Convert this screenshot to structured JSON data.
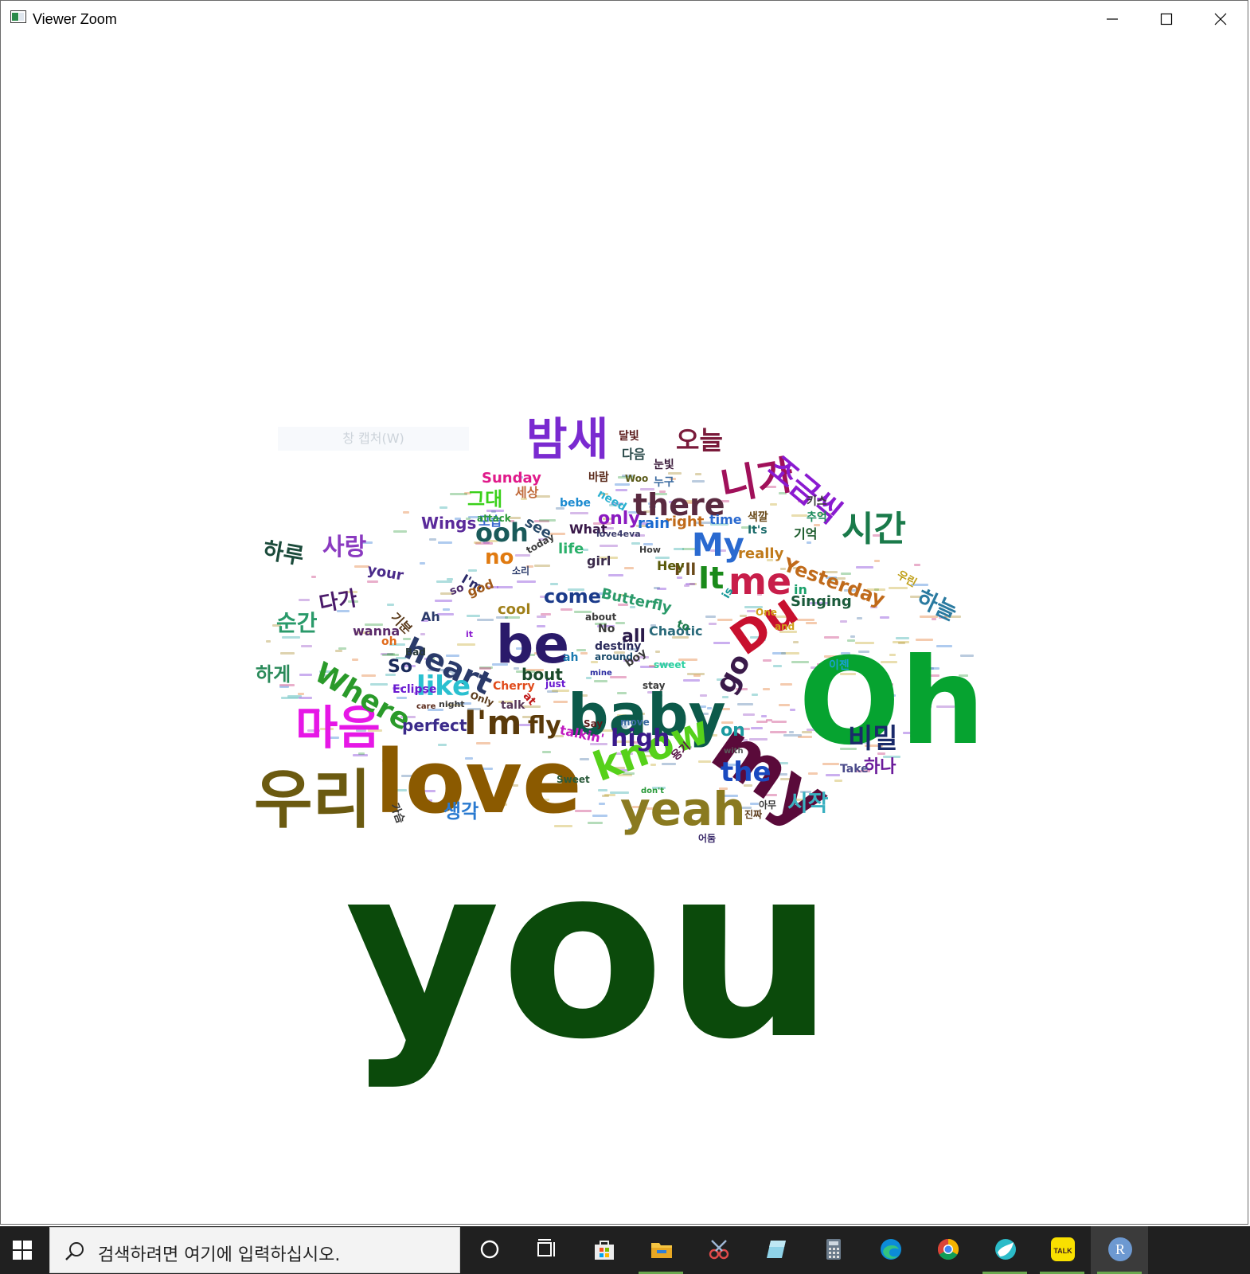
{
  "window": {
    "title": "Viewer Zoom",
    "tooltip_ghost": "창 캡처(W)"
  },
  "wordcloud": {
    "words": [
      {
        "text": "you",
        "color": "#0b4a0b"
      },
      {
        "text": "Oh",
        "color": "#06a330"
      },
      {
        "text": "love",
        "color": "#8b5a00"
      },
      {
        "text": "baby",
        "color": "#0c5a4a"
      },
      {
        "text": "우리",
        "color": "#6b5a10"
      },
      {
        "text": "my",
        "color": "#5a0a3a"
      },
      {
        "text": "be",
        "color": "#2a1a6a"
      },
      {
        "text": "know",
        "color": "#56d11a"
      },
      {
        "text": "yeah",
        "color": "#8a7a20"
      },
      {
        "text": "마음",
        "color": "#e617e6"
      },
      {
        "text": "밤새",
        "color": "#7a2ad0"
      },
      {
        "text": "Du",
        "color": "#c8102e"
      },
      {
        "text": "니가",
        "color": "#a0105a"
      },
      {
        "text": "there",
        "color": "#5a2a40"
      },
      {
        "text": "시간",
        "color": "#1a7a4a"
      },
      {
        "text": "조금씩",
        "color": "#8a1ad0"
      },
      {
        "text": "I'm",
        "color": "#5a3a0a"
      },
      {
        "text": "heart",
        "color": "#2a3a6a"
      },
      {
        "text": "Where",
        "color": "#2a9a2a"
      },
      {
        "text": "me",
        "color": "#c81e4a"
      },
      {
        "text": "My",
        "color": "#2a6ad0"
      },
      {
        "text": "It",
        "color": "#1a8a1a"
      },
      {
        "text": "go",
        "color": "#3a1a4a"
      },
      {
        "text": "like",
        "color": "#2ac0d0"
      },
      {
        "text": "the",
        "color": "#1a4ac0"
      },
      {
        "text": "high",
        "color": "#3a1a8a"
      },
      {
        "text": "fly",
        "color": "#5a3a0a"
      },
      {
        "text": "ooh",
        "color": "#1a5a5a"
      },
      {
        "text": "사랑",
        "color": "#8a3ac0"
      },
      {
        "text": "오늘",
        "color": "#7a1a3a"
      },
      {
        "text": "비밀",
        "color": "#1a2a6a"
      },
      {
        "text": "시작",
        "color": "#3ab0c0"
      },
      {
        "text": "하루",
        "color": "#1a4a3a"
      },
      {
        "text": "순간",
        "color": "#2a9a6a"
      },
      {
        "text": "하늘",
        "color": "#2a7aa0"
      },
      {
        "text": "Yesterday",
        "color": "#c06a1a"
      },
      {
        "text": "no",
        "color": "#e07a10"
      },
      {
        "text": "come",
        "color": "#1a3a8a"
      },
      {
        "text": "only",
        "color": "#8a1ac0"
      },
      {
        "text": "그대",
        "color": "#3ad01a"
      },
      {
        "text": "Wings",
        "color": "#5a2a9a"
      },
      {
        "text": "다가",
        "color": "#4a1a6a"
      },
      {
        "text": "하게",
        "color": "#2a8a5a"
      },
      {
        "text": "생각",
        "color": "#2a7ad0"
      },
      {
        "text": "하나",
        "color": "#6a1a9a"
      },
      {
        "text": "Butterfly",
        "color": "#2a9a6a"
      },
      {
        "text": "perfect",
        "color": "#3a2a8a"
      },
      {
        "text": "bout",
        "color": "#1a4a2a"
      },
      {
        "text": "on",
        "color": "#1a9aa0"
      },
      {
        "text": "all",
        "color": "#2a1a4a"
      },
      {
        "text": "So",
        "color": "#1a2a5a"
      },
      {
        "text": "I'll",
        "color": "#6a4a1a"
      },
      {
        "text": "Singing",
        "color": "#1a5a3a"
      },
      {
        "text": "really",
        "color": "#c07a1a"
      },
      {
        "text": "right",
        "color": "#c06a1a"
      },
      {
        "text": "rain",
        "color": "#1a6ad0"
      },
      {
        "text": "time",
        "color": "#2a6ad0"
      },
      {
        "text": "life",
        "color": "#2ab06a"
      },
      {
        "text": "girl",
        "color": "#3a2a4a"
      },
      {
        "text": "cool",
        "color": "#a0801a"
      },
      {
        "text": "wanna",
        "color": "#5a2a6a"
      },
      {
        "text": "your",
        "color": "#4a2a8a"
      },
      {
        "text": "see",
        "color": "#2a4a6a"
      },
      {
        "text": "모습",
        "color": "#3a6ad0"
      },
      {
        "text": "Sunday",
        "color": "#e01a8a"
      },
      {
        "text": "bebe",
        "color": "#1a8ad0"
      },
      {
        "text": "Chaotic",
        "color": "#2a6a7a"
      },
      {
        "text": "to",
        "color": "#1a7a4a"
      },
      {
        "text": "in",
        "color": "#1aa06a"
      },
      {
        "text": "is",
        "color": "#1a9a9a"
      },
      {
        "text": "Hey",
        "color": "#5a5a0a"
      },
      {
        "text": "talkin'",
        "color": "#c01ac0"
      },
      {
        "text": "용기",
        "color": "#5a1a4a"
      },
      {
        "text": "Take",
        "color": "#4a4a8a"
      },
      {
        "text": "oh",
        "color": "#e06a1a"
      },
      {
        "text": "Ah",
        "color": "#2a3a6a"
      },
      {
        "text": "No",
        "color": "#3a3a3a"
      },
      {
        "text": "What",
        "color": "#3a1a4a"
      },
      {
        "text": "It's",
        "color": "#1a6a6a"
      },
      {
        "text": "I'm",
        "color": "#2a2a6a"
      },
      {
        "text": "god",
        "color": "#a05a1a"
      },
      {
        "text": "talk",
        "color": "#5a3a5a"
      },
      {
        "text": "Eclipse",
        "color": "#6a1ad0"
      },
      {
        "text": "Cherry",
        "color": "#e04a1a"
      },
      {
        "text": "at",
        "color": "#c01a1a"
      },
      {
        "text": "ah",
        "color": "#1a7ab0"
      },
      {
        "text": "destiny",
        "color": "#2a2a5a"
      },
      {
        "text": "move",
        "color": "#3a6aa0"
      },
      {
        "text": "so",
        "color": "#4a2a6a"
      },
      {
        "text": "기분",
        "color": "#5a3a1a"
      },
      {
        "text": "세상",
        "color": "#c06a3a"
      },
      {
        "text": "다음",
        "color": "#2a4a4a"
      },
      {
        "text": "기억",
        "color": "#1a5a2a"
      },
      {
        "text": "색깔",
        "color": "#6a4a1a"
      },
      {
        "text": "추억",
        "color": "#1a8a5a"
      },
      {
        "text": "우린",
        "color": "#c0a01a"
      },
      {
        "text": "키스",
        "color": "#3a3a3a"
      },
      {
        "text": "달빛",
        "color": "#5a1a1a"
      },
      {
        "text": "바람",
        "color": "#5a2a1a"
      },
      {
        "text": "눈빛",
        "color": "#3a1a3a"
      },
      {
        "text": "누구",
        "color": "#3a6aa0"
      },
      {
        "text": "Woo",
        "color": "#5a5a1a"
      },
      {
        "text": "need",
        "color": "#2ab0d0"
      },
      {
        "text": "today",
        "color": "#3a3a3a"
      },
      {
        "text": "attack",
        "color": "#2a9a3a"
      },
      {
        "text": "about",
        "color": "#3a3a3a"
      },
      {
        "text": "around",
        "color": "#1a4a6a"
      },
      {
        "text": "mine",
        "color": "#2a2aa0"
      },
      {
        "text": "One",
        "color": "#d0a01a"
      },
      {
        "text": "and",
        "color": "#d0a01a"
      },
      {
        "text": "boy",
        "color": "#3a3a3a"
      },
      {
        "text": "sweet",
        "color": "#2ad0a0"
      },
      {
        "text": "Sweet",
        "color": "#2a5a3a"
      },
      {
        "text": "with",
        "color": "#5a5a5a"
      },
      {
        "text": "don't",
        "color": "#2a9a3a"
      },
      {
        "text": "Say",
        "color": "#5a1a1a"
      },
      {
        "text": "Bad",
        "color": "#2a3a3a"
      },
      {
        "text": "stay",
        "color": "#3a3a3a"
      },
      {
        "text": "care",
        "color": "#5a2a1a"
      },
      {
        "text": "just",
        "color": "#6a1ad0"
      },
      {
        "text": "Only",
        "color": "#5a3a1a"
      },
      {
        "text": "night",
        "color": "#3a3a3a"
      },
      {
        "text": "love4eva",
        "color": "#3a3a6a"
      },
      {
        "text": "How",
        "color": "#3a3a3a"
      },
      {
        "text": "it",
        "color": "#8a1ad0"
      },
      {
        "text": "소리",
        "color": "#2a3a6a"
      },
      {
        "text": "아무",
        "color": "#3a3a3a"
      },
      {
        "text": "진짜",
        "color": "#5a3a1a"
      },
      {
        "text": "가슴",
        "color": "#3a3a3a"
      },
      {
        "text": "이젠",
        "color": "#1aa0d0"
      },
      {
        "text": "어둠",
        "color": "#3a2a6a"
      }
    ]
  },
  "taskbar": {
    "search_placeholder": "검색하려면 여기에 입력하십시오.",
    "start_icon": "windows-logo-icon",
    "apps": [
      "cortana-icon",
      "task-view-icon",
      "store-icon",
      "file-explorer-icon",
      "snipping-tool-icon",
      "sticky-notes-icon",
      "calculator-icon",
      "edge-icon",
      "chrome-icon",
      "whale-browser-icon",
      "kakaotalk-icon",
      "r-icon"
    ],
    "kakao_label": "TALK",
    "r_label": "R"
  }
}
